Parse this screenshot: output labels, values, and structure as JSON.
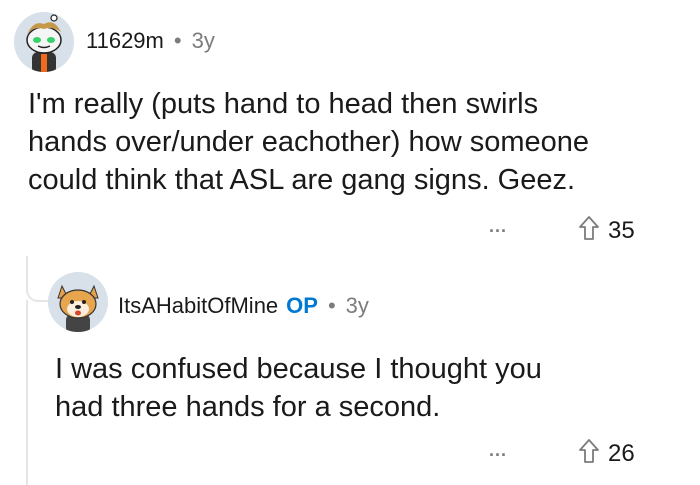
{
  "comments": [
    {
      "username": "11629m",
      "age": "3y",
      "body_lines": [
        "I'm really (puts hand to head then swirls",
        "hands over/under eachother) how someone",
        "could think that ASL are gang signs. Geez."
      ],
      "more_label": "...",
      "upvotes": "35",
      "avatar_icon": "snoo-avatar-icon"
    },
    {
      "username": "ItsAHabitOfMine",
      "op_badge": "OP",
      "age": "3y",
      "body_lines": [
        "I was confused because I thought you",
        "had three hands for a second."
      ],
      "more_label": "...",
      "upvotes": "26",
      "avatar_icon": "shiba-avatar-icon"
    }
  ],
  "separator": "•",
  "colors": {
    "op": "#0079d3",
    "muted": "#7c7c7c",
    "text": "#1a1a1b"
  }
}
